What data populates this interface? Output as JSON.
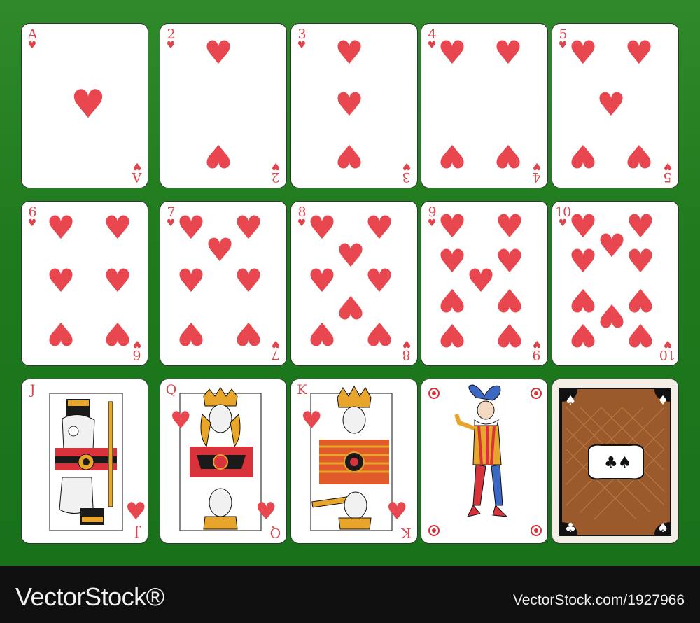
{
  "colors": {
    "felt": "#1f7a1d",
    "heart": "#e8474f",
    "card": "#ffffff",
    "footer": "#0f0f0f"
  },
  "suit_symbol": "♥",
  "cards": [
    {
      "rank": "A",
      "pips": 1
    },
    {
      "rank": "2",
      "pips": 2
    },
    {
      "rank": "3",
      "pips": 3
    },
    {
      "rank": "4",
      "pips": 4
    },
    {
      "rank": "5",
      "pips": 5
    },
    {
      "rank": "6",
      "pips": 6
    },
    {
      "rank": "7",
      "pips": 7
    },
    {
      "rank": "8",
      "pips": 8
    },
    {
      "rank": "9",
      "pips": 9
    },
    {
      "rank": "10",
      "pips": 10
    },
    {
      "rank": "J",
      "face": "jack"
    },
    {
      "rank": "Q",
      "face": "queen"
    },
    {
      "rank": "K",
      "face": "king"
    },
    {
      "rank": "",
      "face": "joker"
    },
    {
      "rank": "",
      "face": "back"
    }
  ],
  "watermark": {
    "left": "VectorStock®",
    "right": "VectorStock.com/1927966"
  }
}
